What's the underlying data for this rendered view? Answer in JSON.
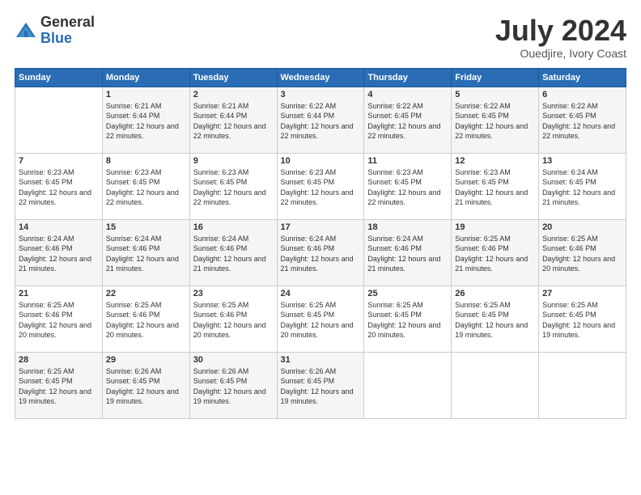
{
  "header": {
    "logo_general": "General",
    "logo_blue": "Blue",
    "month_title": "July 2024",
    "location": "Ouedjire, Ivory Coast"
  },
  "days_of_week": [
    "Sunday",
    "Monday",
    "Tuesday",
    "Wednesday",
    "Thursday",
    "Friday",
    "Saturday"
  ],
  "weeks": [
    [
      {
        "day": "",
        "sunrise": "",
        "sunset": "",
        "daylight": ""
      },
      {
        "day": "1",
        "sunrise": "Sunrise: 6:21 AM",
        "sunset": "Sunset: 6:44 PM",
        "daylight": "Daylight: 12 hours and 22 minutes."
      },
      {
        "day": "2",
        "sunrise": "Sunrise: 6:21 AM",
        "sunset": "Sunset: 6:44 PM",
        "daylight": "Daylight: 12 hours and 22 minutes."
      },
      {
        "day": "3",
        "sunrise": "Sunrise: 6:22 AM",
        "sunset": "Sunset: 6:44 PM",
        "daylight": "Daylight: 12 hours and 22 minutes."
      },
      {
        "day": "4",
        "sunrise": "Sunrise: 6:22 AM",
        "sunset": "Sunset: 6:45 PM",
        "daylight": "Daylight: 12 hours and 22 minutes."
      },
      {
        "day": "5",
        "sunrise": "Sunrise: 6:22 AM",
        "sunset": "Sunset: 6:45 PM",
        "daylight": "Daylight: 12 hours and 22 minutes."
      },
      {
        "day": "6",
        "sunrise": "Sunrise: 6:22 AM",
        "sunset": "Sunset: 6:45 PM",
        "daylight": "Daylight: 12 hours and 22 minutes."
      }
    ],
    [
      {
        "day": "7",
        "sunrise": "Sunrise: 6:23 AM",
        "sunset": "Sunset: 6:45 PM",
        "daylight": "Daylight: 12 hours and 22 minutes."
      },
      {
        "day": "8",
        "sunrise": "Sunrise: 6:23 AM",
        "sunset": "Sunset: 6:45 PM",
        "daylight": "Daylight: 12 hours and 22 minutes."
      },
      {
        "day": "9",
        "sunrise": "Sunrise: 6:23 AM",
        "sunset": "Sunset: 6:45 PM",
        "daylight": "Daylight: 12 hours and 22 minutes."
      },
      {
        "day": "10",
        "sunrise": "Sunrise: 6:23 AM",
        "sunset": "Sunset: 6:45 PM",
        "daylight": "Daylight: 12 hours and 22 minutes."
      },
      {
        "day": "11",
        "sunrise": "Sunrise: 6:23 AM",
        "sunset": "Sunset: 6:45 PM",
        "daylight": "Daylight: 12 hours and 22 minutes."
      },
      {
        "day": "12",
        "sunrise": "Sunrise: 6:23 AM",
        "sunset": "Sunset: 6:45 PM",
        "daylight": "Daylight: 12 hours and 21 minutes."
      },
      {
        "day": "13",
        "sunrise": "Sunrise: 6:24 AM",
        "sunset": "Sunset: 6:45 PM",
        "daylight": "Daylight: 12 hours and 21 minutes."
      }
    ],
    [
      {
        "day": "14",
        "sunrise": "Sunrise: 6:24 AM",
        "sunset": "Sunset: 6:46 PM",
        "daylight": "Daylight: 12 hours and 21 minutes."
      },
      {
        "day": "15",
        "sunrise": "Sunrise: 6:24 AM",
        "sunset": "Sunset: 6:46 PM",
        "daylight": "Daylight: 12 hours and 21 minutes."
      },
      {
        "day": "16",
        "sunrise": "Sunrise: 6:24 AM",
        "sunset": "Sunset: 6:46 PM",
        "daylight": "Daylight: 12 hours and 21 minutes."
      },
      {
        "day": "17",
        "sunrise": "Sunrise: 6:24 AM",
        "sunset": "Sunset: 6:46 PM",
        "daylight": "Daylight: 12 hours and 21 minutes."
      },
      {
        "day": "18",
        "sunrise": "Sunrise: 6:24 AM",
        "sunset": "Sunset: 6:46 PM",
        "daylight": "Daylight: 12 hours and 21 minutes."
      },
      {
        "day": "19",
        "sunrise": "Sunrise: 6:25 AM",
        "sunset": "Sunset: 6:46 PM",
        "daylight": "Daylight: 12 hours and 21 minutes."
      },
      {
        "day": "20",
        "sunrise": "Sunrise: 6:25 AM",
        "sunset": "Sunset: 6:46 PM",
        "daylight": "Daylight: 12 hours and 20 minutes."
      }
    ],
    [
      {
        "day": "21",
        "sunrise": "Sunrise: 6:25 AM",
        "sunset": "Sunset: 6:46 PM",
        "daylight": "Daylight: 12 hours and 20 minutes."
      },
      {
        "day": "22",
        "sunrise": "Sunrise: 6:25 AM",
        "sunset": "Sunset: 6:46 PM",
        "daylight": "Daylight: 12 hours and 20 minutes."
      },
      {
        "day": "23",
        "sunrise": "Sunrise: 6:25 AM",
        "sunset": "Sunset: 6:46 PM",
        "daylight": "Daylight: 12 hours and 20 minutes."
      },
      {
        "day": "24",
        "sunrise": "Sunrise: 6:25 AM",
        "sunset": "Sunset: 6:45 PM",
        "daylight": "Daylight: 12 hours and 20 minutes."
      },
      {
        "day": "25",
        "sunrise": "Sunrise: 6:25 AM",
        "sunset": "Sunset: 6:45 PM",
        "daylight": "Daylight: 12 hours and 20 minutes."
      },
      {
        "day": "26",
        "sunrise": "Sunrise: 6:25 AM",
        "sunset": "Sunset: 6:45 PM",
        "daylight": "Daylight: 12 hours and 19 minutes."
      },
      {
        "day": "27",
        "sunrise": "Sunrise: 6:25 AM",
        "sunset": "Sunset: 6:45 PM",
        "daylight": "Daylight: 12 hours and 19 minutes."
      }
    ],
    [
      {
        "day": "28",
        "sunrise": "Sunrise: 6:25 AM",
        "sunset": "Sunset: 6:45 PM",
        "daylight": "Daylight: 12 hours and 19 minutes."
      },
      {
        "day": "29",
        "sunrise": "Sunrise: 6:26 AM",
        "sunset": "Sunset: 6:45 PM",
        "daylight": "Daylight: 12 hours and 19 minutes."
      },
      {
        "day": "30",
        "sunrise": "Sunrise: 6:26 AM",
        "sunset": "Sunset: 6:45 PM",
        "daylight": "Daylight: 12 hours and 19 minutes."
      },
      {
        "day": "31",
        "sunrise": "Sunrise: 6:26 AM",
        "sunset": "Sunset: 6:45 PM",
        "daylight": "Daylight: 12 hours and 19 minutes."
      },
      {
        "day": "",
        "sunrise": "",
        "sunset": "",
        "daylight": ""
      },
      {
        "day": "",
        "sunrise": "",
        "sunset": "",
        "daylight": ""
      },
      {
        "day": "",
        "sunrise": "",
        "sunset": "",
        "daylight": ""
      }
    ]
  ]
}
